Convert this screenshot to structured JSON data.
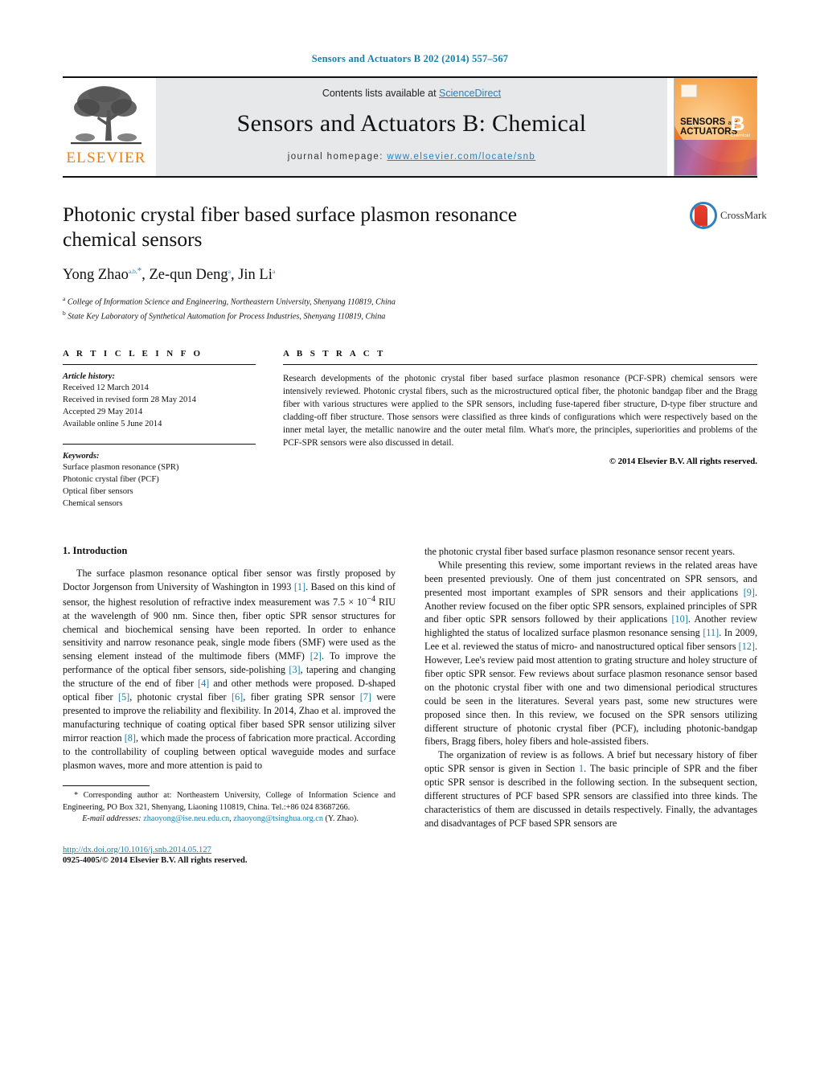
{
  "running_head": "Sensors and Actuators B 202 (2014) 557–567",
  "journal_header": {
    "contents_prefix": "Contents lists available at ",
    "contents_link": "ScienceDirect",
    "journal_title": "Sensors and Actuators B: Chemical",
    "homepage_label": "journal homepage:",
    "homepage_url": "www.elsevier.com/locate/snb",
    "publisher_logo_text": "ELSEVIER",
    "cover": {
      "line1": "SENSORS",
      "line1_small": "and",
      "line2": "ACTUATORS",
      "letter": "B",
      "letter_sub": "Chemical"
    }
  },
  "article": {
    "title": "Photonic crystal fiber based surface plasmon resonance chemical sensors",
    "authors_html": "Yong Zhao<sup class=\"affil-mark\">a,b,</sup><sup class=\"star\">*</sup>, Ze-qun Deng<sup class=\"affil-mark\">a</sup>, Jin Li<sup class=\"affil-mark\">a</sup>",
    "affiliations": [
      {
        "mark": "a",
        "text": "College of Information Science and Engineering, Northeastern University, Shenyang 110819, China"
      },
      {
        "mark": "b",
        "text": "State Key Laboratory of Synthetical Automation for Process Industries, Shenyang 110819, China"
      }
    ],
    "crossmark_label": "CrossMark"
  },
  "article_info": {
    "heading": "A R T I C L E    I N F O",
    "history_label": "Article history:",
    "history": [
      "Received 12 March 2014",
      "Received in revised form 28 May 2014",
      "Accepted 29 May 2014",
      "Available online 5 June 2014"
    ],
    "keywords_label": "Keywords:",
    "keywords": [
      "Surface plasmon resonance (SPR)",
      "Photonic crystal fiber (PCF)",
      "Optical fiber sensors",
      "Chemical sensors"
    ]
  },
  "abstract": {
    "heading": "A B S T R A C T",
    "text": "Research developments of the photonic crystal fiber based surface plasmon resonance (PCF-SPR) chemical sensors were intensively reviewed. Photonic crystal fibers, such as the microstructured optical fiber, the photonic bandgap fiber and the Bragg fiber with various structures were applied to the SPR sensors, including fuse-tapered fiber structure, D-type fiber structure and cladding-off fiber structure. Those sensors were classified as three kinds of configurations which were respectively based on the inner metal layer, the metallic nanowire and the outer metal film. What's more, the principles, superiorities and problems of the PCF-SPR sensors were also discussed in detail.",
    "copyright": "© 2014 Elsevier B.V. All rights reserved."
  },
  "body": {
    "section_title": "1.  Introduction",
    "left_paragraph_html": "The surface plasmon resonance optical fiber sensor was firstly proposed by Doctor Jorgenson from University of Washington in 1993 <span class=\"cit\">[1]</span>. Based on this kind of sensor, the highest resolution of refractive index measurement was 7.5 &#215; 10<sup>&#8722;4</sup> RIU at the wavelength of 900 nm. Since then, fiber optic SPR sensor structures for chemical and biochemical sensing have been reported. In order to enhance sensitivity and narrow resonance peak, single mode fibers (SMF) were used as the sensing element instead of the multimode fibers (MMF) <span class=\"cit\">[2]</span>. To improve the performance of the optical fiber sensors, side-polishing <span class=\"cit\">[3]</span>, tapering and changing the structure of the end of fiber <span class=\"cit\">[4]</span> and other methods were proposed. D-shaped optical fiber <span class=\"cit\">[5]</span>, photonic crystal fiber <span class=\"cit\">[6]</span>, fiber grating SPR sensor <span class=\"cit\">[7]</span> were presented to improve the reliability and flexibility. In 2014, Zhao et al. improved the manufacturing technique of coating optical fiber based SPR sensor utilizing silver mirror reaction <span class=\"cit\">[8]</span>, which made the process of fabrication more practical. According to the controllability of coupling between optical waveguide modes and surface plasmon waves, more and more attention is paid to",
    "right_paragraph1_html": "the photonic crystal fiber based surface plasmon resonance sensor recent years.",
    "right_paragraph2_html": "While presenting this review, some important reviews in the related areas have been presented previously. One of them just concentrated on SPR sensors, and presented most important examples of SPR sensors and their applications <span class=\"cit\">[9]</span>. Another review focused on the fiber optic SPR sensors, explained principles of SPR and fiber optic SPR sensors followed by their applications <span class=\"cit\">[10]</span>. Another review highlighted the status of localized surface plasmon resonance sensing <span class=\"cit\">[11]</span>. In 2009, Lee et al. reviewed the status of micro- and nanostructured optical fiber sensors <span class=\"cit\">[12]</span>. However, Lee's review paid most attention to grating structure and holey structure of fiber optic SPR sensor. Few reviews about surface plasmon resonance sensor based on the photonic crystal fiber with one and two dimensional periodical structures could be seen in the literatures. Several years past, some new structures were proposed since then. In this review, we focused on the SPR sensors utilizing different structure of photonic crystal fiber (PCF), including photonic-bandgap fibers, Bragg fibers, holey fibers and hole-assisted fibers.",
    "right_paragraph3_html": "The organization of review is as follows. A brief but necessary history of fiber optic SPR sensor is given in Section <span class=\"cit\">1</span>. The basic principle of SPR and the fiber optic SPR sensor is described in the following section. In the subsequent section, different structures of PCF based SPR sensors are classified into three kinds. The characteristics of them are discussed in details respectively. Finally, the advantages and disadvantages of PCF based SPR sensors are"
  },
  "footnote": {
    "corresponding_html": "<span class=\"ind\"></span>* Corresponding author at: Northeastern University, College of Information Science and Engineering, PO Box 321, Shenyang, Liaoning 110819, China. Tel.:+86 024 83687266.",
    "email_label": "E-mail addresses:",
    "email1": "zhaoyong@ise.neu.edu.cn",
    "email2": "zhaoyong@tsinghua.org.cn",
    "email_suffix": "(Y. Zhao).",
    "doi": "http://dx.doi.org/10.1016/j.snb.2014.05.127",
    "issn_copyright": "0925-4005/© 2014 Elsevier B.V. All rights reserved."
  },
  "colors": {
    "link_blue": "#1a7fa8",
    "elsevier_orange": "#f08010",
    "band_gray": "#e7e8ea",
    "crossmark_blue": "#2f7fc1",
    "crossmark_red": "#e8402e"
  }
}
